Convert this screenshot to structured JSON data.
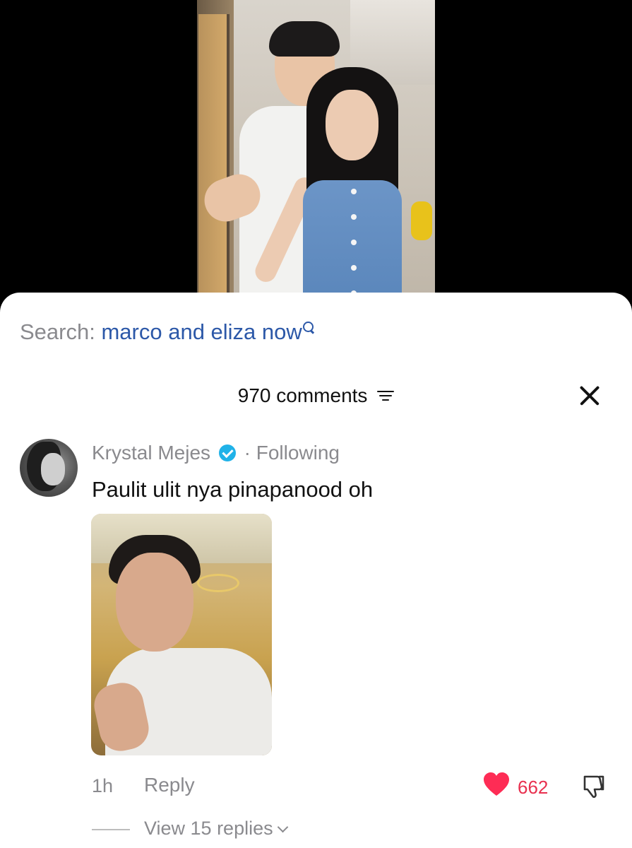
{
  "search": {
    "label": "Search:",
    "query": "marco and eliza now",
    "icon": "search-icon"
  },
  "comments_header": {
    "count_label": "970 comments",
    "filter_icon": "filter-icon",
    "close_icon": "close-icon"
  },
  "comment": {
    "username": "Krystal Mejes",
    "verified_icon": "verified-icon",
    "separator": "·",
    "relation": "Following",
    "text": "Paulit ulit nya pinapanood oh",
    "time": "1h",
    "reply_label": "Reply",
    "like_count": "662",
    "like_color": "#fe2c55",
    "view_replies_label": "View 15 replies"
  },
  "colors": {
    "link": "#2c58a8",
    "muted": "#8a8a8e",
    "verified": "#20b2e8",
    "like": "#e8304f"
  }
}
